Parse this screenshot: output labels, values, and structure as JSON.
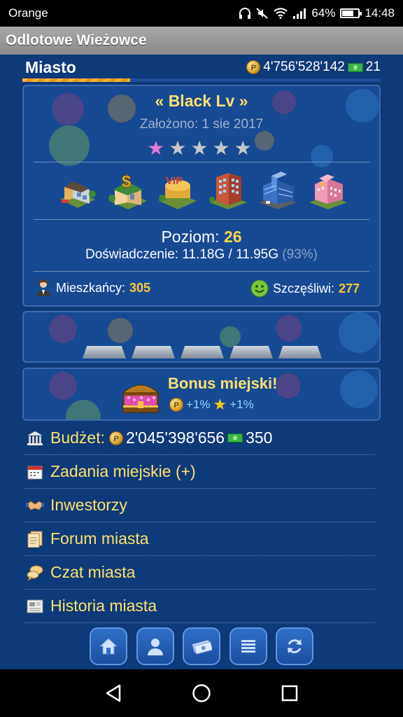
{
  "status_bar": {
    "carrier": "Orange",
    "battery": "64%",
    "time": "14:48"
  },
  "app": {
    "title": "Odlotowe Wieżowce"
  },
  "header": {
    "page_title": "Miasto",
    "coins": "4'756'528'142",
    "cash": "21",
    "xp_progress_percent": 30
  },
  "city": {
    "name": "« Black Lv »",
    "founded": "Założono: 1 sie 2017",
    "stars_total": 5,
    "stars_earned": 1,
    "buildings": [
      "residential-building-icon",
      "bank-building-icon",
      "vip-building-icon",
      "apartment-building-icon",
      "office-tower-icon",
      "pink-hotel-icon"
    ],
    "level_label": "Poziom:",
    "level_value": "26",
    "experience": "Doświadczenie: 11.18G / 11.95G",
    "experience_pct": "(93%)",
    "residents_label": "Mieszkańcy:",
    "residents_value": "305",
    "happy_label": "Szczęśliwi:",
    "happy_value": "277"
  },
  "bonus": {
    "title": "Bonus miejski!",
    "coin_bonus": "+1%",
    "star_bonus": "+1%"
  },
  "menu": {
    "budget_label": "Budżet:",
    "budget_coins": "2'045'398'656",
    "budget_cash": "350",
    "items": [
      "Zadania miejskie (+)",
      "Inwestorzy",
      "Forum miasta",
      "Czat miasta",
      "Historia miasta"
    ]
  },
  "bottom_nav": [
    "home-icon",
    "profile-icon",
    "money-icon",
    "list-icon",
    "refresh-icon"
  ],
  "colors": {
    "background": "#0d3a78",
    "panel": "#164a93",
    "accent_yellow": "#ffe06e",
    "value_orange": "#ffc63b"
  }
}
